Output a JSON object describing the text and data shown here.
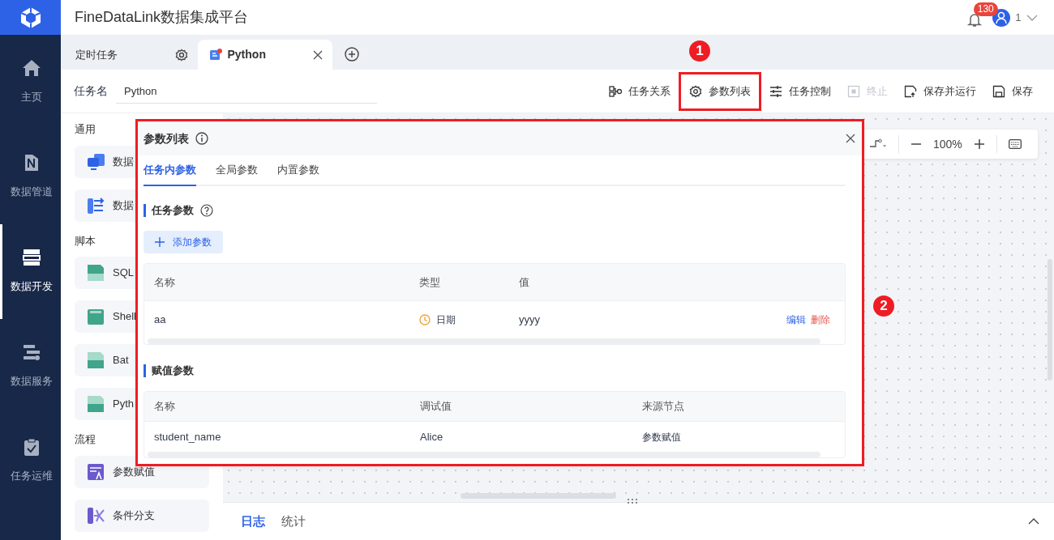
{
  "app": {
    "title": "FineDataLink数据集成平台",
    "notification_count": "130",
    "user": "1"
  },
  "nav": [
    {
      "label": "主页",
      "kind": "home",
      "selected": false
    },
    {
      "label": "数据管道",
      "kind": "pipeline",
      "selected": false
    },
    {
      "label": "数据开发",
      "kind": "dev",
      "selected": true
    },
    {
      "label": "数据服务",
      "kind": "service",
      "selected": false
    },
    {
      "label": "任务运维",
      "kind": "ops",
      "selected": false
    }
  ],
  "tabs": [
    {
      "label": "定时任务",
      "kind": "folder",
      "selected": false
    },
    {
      "label": "Python",
      "kind": "script",
      "selected": true
    }
  ],
  "task_name": {
    "label": "任务名",
    "value": "Python"
  },
  "toolbar": [
    {
      "label": "任务关系",
      "kind": "relation",
      "disabled": false,
      "highlighted": false
    },
    {
      "label": "参数列表",
      "kind": "params",
      "disabled": false,
      "highlighted": true
    },
    {
      "label": "任务控制",
      "kind": "control",
      "disabled": false,
      "highlighted": false
    },
    {
      "label": "终止",
      "kind": "stop",
      "disabled": true,
      "highlighted": false
    },
    {
      "label": "保存并运行",
      "kind": "saverun",
      "disabled": false,
      "highlighted": false
    },
    {
      "label": "保存",
      "kind": "save",
      "disabled": false,
      "highlighted": false
    }
  ],
  "palette": [
    {
      "heading": "通用",
      "items": [
        {
          "label": "数据",
          "kind": "sync"
        },
        {
          "label": "数据",
          "kind": "transform"
        }
      ]
    },
    {
      "heading": "脚本",
      "items": [
        {
          "label": "SQL",
          "kind": "sql"
        },
        {
          "label": "Shell",
          "kind": "shell"
        },
        {
          "label": "Bat",
          "kind": "bat"
        },
        {
          "label": "Pyth",
          "kind": "python"
        }
      ]
    },
    {
      "heading": "流程",
      "items": [
        {
          "label": "参数赋值",
          "kind": "assign"
        },
        {
          "label": "条件分支",
          "kind": "branch"
        }
      ]
    }
  ],
  "canvas_toolbar": {
    "zoom": "100%"
  },
  "param_panel": {
    "title": "参数列表",
    "highlighted": true,
    "tabs": [
      {
        "label": "任务内参数",
        "selected": true
      },
      {
        "label": "全局参数",
        "selected": false
      },
      {
        "label": "内置参数",
        "selected": false
      }
    ],
    "task_params": {
      "title": "任务参数",
      "add_button": "添加参数",
      "columns": [
        "名称",
        "类型",
        "值"
      ],
      "rows": [
        {
          "name": "aa",
          "type": {
            "label": "日期",
            "kind": "date"
          },
          "value": "yyyy",
          "actions": [
            {
              "label": "编辑",
              "kind": "edit"
            },
            {
              "label": "删除",
              "kind": "delete"
            }
          ]
        }
      ]
    },
    "assign_params": {
      "title": "赋值参数",
      "columns": [
        "名称",
        "调试值",
        "来源节点"
      ],
      "rows": [
        {
          "name": "student_name",
          "debug_value": "Alice",
          "source": "参数赋值"
        }
      ]
    }
  },
  "callouts": [
    {
      "number": "1"
    },
    {
      "number": "2"
    }
  ],
  "bottom_tabs": [
    {
      "label": "日志",
      "selected": true
    },
    {
      "label": "统计",
      "selected": false
    }
  ]
}
